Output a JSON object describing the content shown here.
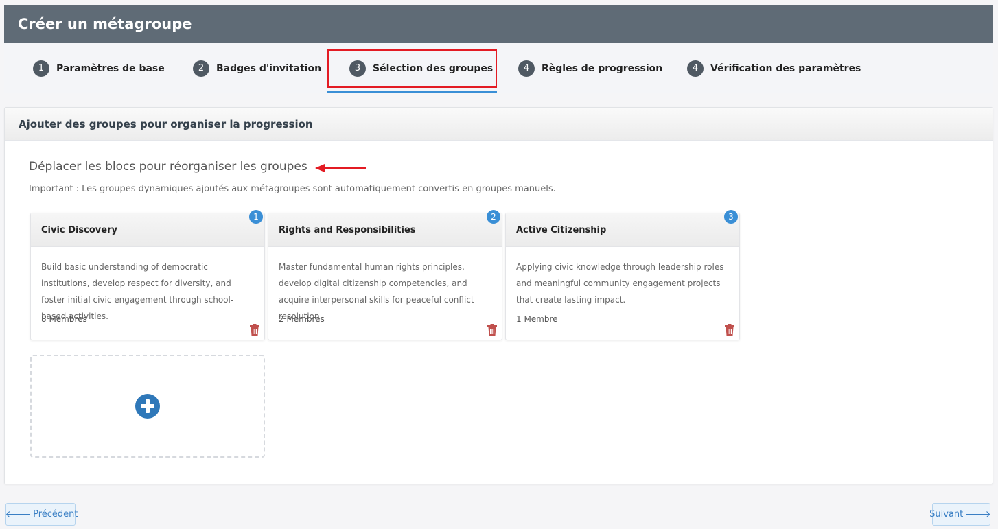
{
  "header": {
    "title": "Créer un métagroupe"
  },
  "steps": [
    {
      "num": "1",
      "label": "Paramètres de base"
    },
    {
      "num": "2",
      "label": "Badges d'invitation"
    },
    {
      "num": "3",
      "label": "Sélection des groupes"
    },
    {
      "num": "4",
      "label": "Règles de progression"
    },
    {
      "num": "4",
      "label": "Vérification des paramètres"
    }
  ],
  "panel": {
    "title": "Ajouter des groupes pour organiser la progression",
    "instruction": "Déplacer les blocs pour réorganiser les groupes",
    "note": "Important : Les groupes dynamiques ajoutés aux métagroupes sont automatiquement convertis en groupes manuels."
  },
  "groups": [
    {
      "order": "1",
      "name": "Civic Discovery",
      "description": "Build basic understanding of democratic institutions, develop respect for diversity, and foster initial civic engagement through school-based activities.",
      "members": "8 Membres"
    },
    {
      "order": "2",
      "name": "Rights and Responsibilities",
      "description": "Master fundamental human rights principles, develop digital citizenship competencies, and acquire interpersonal skills for peaceful conflict resolution.",
      "members": "2 Membres"
    },
    {
      "order": "3",
      "name": "Active Citizenship",
      "description": "Applying civic knowledge through leadership roles and meaningful community engagement projects that create lasting impact.",
      "members": "1 Membre"
    }
  ],
  "footer": {
    "prev_label": "Précédent",
    "next_label": "Suivant"
  },
  "colors": {
    "header_bg": "#5f6b76",
    "accent": "#3a8fd6",
    "highlight": "#e31b23",
    "trash": "#c0504d"
  }
}
